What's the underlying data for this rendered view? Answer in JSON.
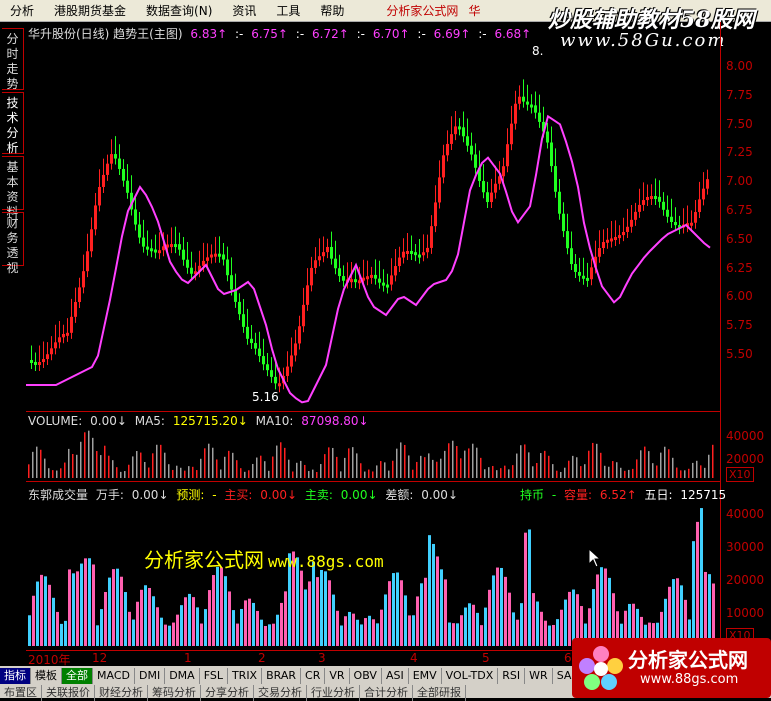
{
  "menu": {
    "items": [
      "分析",
      "港股期货基金",
      "数据查询(N)",
      "资讯",
      "工具",
      "帮助"
    ],
    "brand": "分析家公式网",
    "brand_tail": "华"
  },
  "watermarks": {
    "top": "炒股辅助教材58股网",
    "top_url": "www.58Gu.com",
    "middle": "分析家公式网",
    "middle_url": "www.88gs.com",
    "logo_title": "分析家公式网",
    "logo_url": "www.88gs.com"
  },
  "sidebar": [
    "分时走势",
    "技术分析",
    "基本资料",
    "财务透视"
  ],
  "main": {
    "title": "华升股份(日线) 趋势王(主图)",
    "ma_values": [
      "6.83↑",
      ":-",
      "6.75↑",
      ":-",
      "6.72↑",
      ":-",
      "6.70↑",
      ":-",
      "6.69↑",
      ":-",
      "6.68↑",
      ":-"
    ],
    "y_ticks": [
      "8.00",
      "7.75",
      "7.50",
      "7.25",
      "7.00",
      "6.75",
      "6.50",
      "6.25",
      "6.00",
      "5.75",
      "5.50"
    ],
    "high_marker": "8.",
    "low_marker": "5.16"
  },
  "volume": {
    "label": "VOLUME:",
    "value": "0.00↓",
    "ma5_label": "MA5:",
    "ma5": "125715.20↓",
    "ma10_label": "MA10:",
    "ma10": "87098.80↓",
    "y_ticks": [
      "40000",
      "20000"
    ],
    "unit": "X10"
  },
  "indicator": {
    "name": "东郭成交量",
    "unit": "万手:",
    "unit_val": "0.00↓",
    "yuce_label": "预测:",
    "yuce_val": "-",
    "zhumai_label": "主买:",
    "zhumai_val": "0.00↓",
    "zhumai2_label": "主卖:",
    "zhumai2_val": "0.00↓",
    "cha_label": "差额:",
    "cha_val": "0.00↓",
    "chi_label": "持币",
    "chi_val": "-",
    "rongliang_label": "容量:",
    "rongliang_val": "6.52↑",
    "wuri_label": "五日:",
    "wuri_val": "125715",
    "y_ticks": [
      "40000",
      "30000",
      "20000",
      "10000"
    ],
    "unit_box": "X10"
  },
  "dates": [
    "2010年",
    "12",
    "1",
    "2",
    "3",
    "4",
    "5",
    "6"
  ],
  "tabs_row1": [
    "指标",
    "模板",
    "全部",
    "MACD",
    "DMI",
    "DMA",
    "FSL",
    "TRIX",
    "BRAR",
    "CR",
    "VR",
    "OBV",
    "ASI",
    "EMV",
    "VOL-TDX",
    "RSI",
    "WR",
    "SAR",
    "KDJ",
    "CC"
  ],
  "tabs_row2": [
    "布置区",
    "关联报价",
    "财经分析",
    "筹码分析",
    "分享分析",
    "交易分析",
    "行业分析",
    "合计分析",
    "全部研报"
  ],
  "colors": {
    "up": "#ff2020",
    "down": "#20ff20",
    "ma": "#ff40ff",
    "axis": "#c00000",
    "vol_up": "#ff60b0",
    "vol_down": "#40d0ff"
  }
}
